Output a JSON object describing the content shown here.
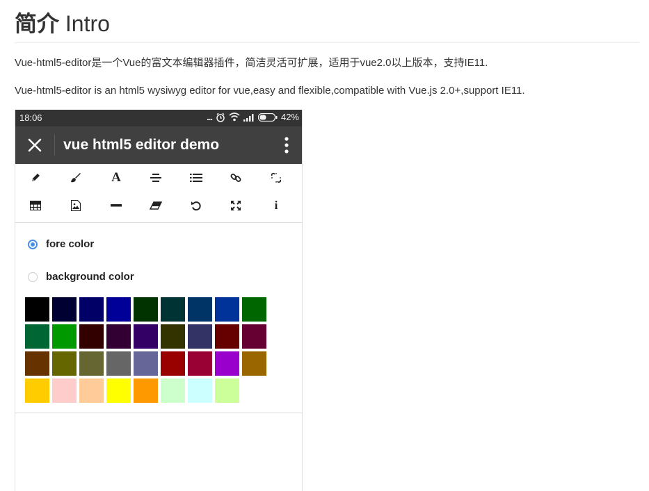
{
  "header": {
    "title_cn": "简介",
    "title_en": "Intro"
  },
  "paragraphs": {
    "p1": "Vue-html5-editor是一个Vue的富文本编辑器插件，简洁灵活可扩展，适用于vue2.0以上版本，支持IE11.",
    "p2": "Vue-html5-editor is an html5 wysiwyg editor for vue,easy and flexible,compatible with Vue.js 2.0+,support IE11."
  },
  "phone": {
    "status": {
      "time": "18:06",
      "dots": "...",
      "battery": "42%"
    },
    "appbar": {
      "title": "vue html5 editor demo"
    },
    "toolbar": {
      "icons": [
        "pencil-icon",
        "brush-icon",
        "font-icon",
        "align-icon",
        "list-icon",
        "link-icon",
        "unlink-icon",
        "table-icon",
        "image-icon",
        "hr-icon",
        "eraser-icon",
        "undo-icon",
        "fullscreen-icon",
        "info-icon"
      ],
      "font_glyph": "A",
      "info_glyph": "i"
    },
    "color_panel": {
      "fore_label": "fore color",
      "background_label": "background color",
      "selected": "fore color",
      "colors": [
        "#000000",
        "#000033",
        "#000066",
        "#000099",
        "#003300",
        "#003333",
        "#003366",
        "#003399",
        "#006600",
        "#006633",
        "#009900",
        "#330000",
        "#330033",
        "#330066",
        "#333300",
        "#333366",
        "#660000",
        "#660033",
        "#663300",
        "#666600",
        "#666633",
        "#666666",
        "#666699",
        "#990000",
        "#990033",
        "#9900cc",
        "#996600",
        "#ffcc00",
        "#ffcccc",
        "#ffcc99",
        "#ffff00",
        "#ff9900",
        "#ccffcc",
        "#ccffff",
        "#ccff99"
      ]
    }
  },
  "theme": {
    "accent": "#4a90e2",
    "statusbar": "#333333",
    "appbar": "#404040"
  }
}
